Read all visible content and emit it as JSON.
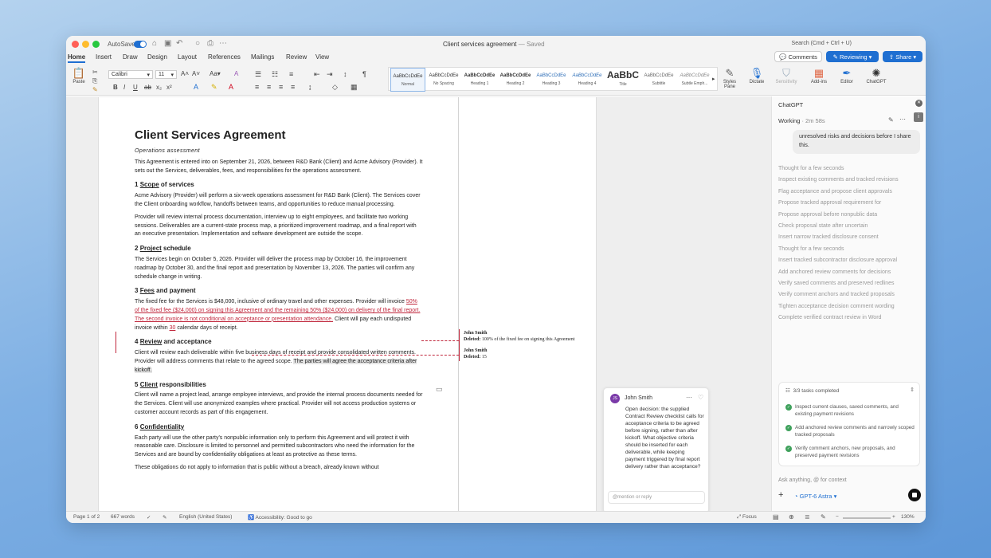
{
  "window": {
    "title": "Client services agreement",
    "saved": "— Saved",
    "autosave": "AutoSave"
  },
  "search": {
    "placeholder": "Search (Cmd + Ctrl + U)"
  },
  "tabs": [
    "Home",
    "Insert",
    "Draw",
    "Design",
    "Layout",
    "References",
    "Mailings",
    "Review",
    "View"
  ],
  "buttons": {
    "comments": "Comments",
    "reviewing": "Reviewing",
    "share": "Share"
  },
  "ribbon": {
    "paste": "Paste",
    "font": "Calibri",
    "size": "11",
    "styles": [
      {
        "sample": "AaBbCcDdEe",
        "name": "Normal"
      },
      {
        "sample": "AaBbCcDdEe",
        "name": "No Spacing"
      },
      {
        "sample": "AaBbCcDdEe",
        "name": "Heading 1"
      },
      {
        "sample": "AaBbCcDdEe",
        "name": "Heading 2"
      },
      {
        "sample": "AaBbCcDdEe",
        "name": "Heading 3"
      },
      {
        "sample": "AaBbCcDdEe",
        "name": "Heading 4"
      },
      {
        "sample": "AaBbC",
        "name": "Title"
      },
      {
        "sample": "AaBbCcDdEe",
        "name": "Subtitle"
      },
      {
        "sample": "AaBbCcDdEe",
        "name": "Subtle Emph..."
      }
    ],
    "tools": [
      "Styles Pane",
      "Dictate",
      "Sensitivity",
      "Add-ins",
      "Editor",
      "ChatGPT"
    ]
  },
  "doc": {
    "title": "Client Services Agreement",
    "subtitle": "Operations assessment",
    "intro": "This Agreement is entered into on September 21, 2026, between R&D Bank (Client) and Acme Advisory (Provider). It sets out the Services, deliverables, fees, and responsibilities for the operations assessment.",
    "s1_num": "1",
    "s1_u": "Scope",
    "s1_rest": " of services",
    "s1_p1": "Acme Advisory (Provider) will perform a six-week operations assessment for R&D Bank (Client). The Services cover the Client onboarding workflow, handoffs between teams, and opportunities to reduce manual processing.",
    "s1_p2": "Provider will review internal process documentation, interview up to eight employees, and facilitate two working sessions. Deliverables are a current-state process map, a prioritized improvement roadmap, and a final report with an executive presentation. Implementation and software development are outside the scope.",
    "s2_num": "2",
    "s2_u": "Project",
    "s2_rest": " schedule",
    "s2_p1": "The Services begin on October 5, 2026. Provider will deliver the process map by October 16, the improvement roadmap by October 30, and the final report and presentation by November 13, 2026. The parties will confirm any schedule change in writing.",
    "s3_num": "3",
    "s3_u": "Fees",
    "s3_rest": " and payment",
    "s3_a": "The fixed fee for the Services is $48,000, inclusive of ordinary travel and other expenses. Provider will invoice ",
    "s3_red": "50% of the fixed fee ($24,000) on signing this Agreement and the remaining 50% ($24,000) on delivery of the final report. The second invoice is not conditional on acceptance or presentation attendance.",
    "s3_b": " Client will pay each undisputed invoice within ",
    "s3_red2": "30",
    "s3_c": " calendar days of receipt.",
    "s4_num": "4",
    "s4_u": "Review",
    "s4_rest": " and acceptance",
    "s4_a": "Client will review each deliverable within five business days of receipt and provide consolidated written comments. Provider will address comments that relate to the agreed scope. ",
    "s4_hl": "The parties will agree the acceptance criteria after kickoff.",
    "s5_num": "5",
    "s5_u": "Client",
    "s5_rest": " responsibilities",
    "s5_p1": "Client will name a project lead, arrange employee interviews, and provide the internal process documents needed for the Services. Client will use anonymized examples where practical. Provider will not access production systems or customer account records as part of this engagement.",
    "s6_num": "6",
    "s6_u": "Confidentiality",
    "s6_rest": "",
    "s6_p1": "Each party will use the other party's nonpublic information only to perform this Agreement and will protect it with reasonable care. Disclosure is limited to personnel and permitted subcontractors who need the information for the Services and are bound by confidentiality obligations at least as protective as these terms.",
    "s6_p2": "These obligations do not apply to information that is public without a breach, already known without"
  },
  "markup": [
    {
      "author": "John Smith",
      "label": "Deleted:",
      "text": " 100% of the fixed fee on signing this Agreement"
    },
    {
      "author": "John Smith",
      "label": "Deleted:",
      "text": " 15"
    }
  ],
  "comment": {
    "initials": "JS",
    "author": "John Smith",
    "body": "Open decision: the supplied Contract Review checklist calls for acceptance criteria to be agreed before signing, rather than after kickoff. What objective criteria should be inserted for each deliverable, while keeping payment triggered by final report delivery rather than acceptance?",
    "reply_placeholder": "@mention or reply"
  },
  "panel": {
    "title": "ChatGPT",
    "status": "Working",
    "elapsed": "· 2m 58s",
    "bubble": "unresolved risks and decisions before I share this.",
    "steps": [
      "Thought for a few seconds",
      "Inspect existing comments and tracked revisions",
      "Flag acceptance and propose client approvals",
      "Propose tracked approval requirement for",
      "Propose approval before nonpublic data",
      "Check proposal state after uncertain",
      "Insert narrow tracked disclosure consent",
      "Thought for a few seconds",
      "Insert tracked subcontractor disclosure approval",
      "Add anchored review comments for decisions",
      "Verify saved comments and preserved redlines",
      "Verify comment anchors and tracked proposals",
      "Tighten acceptance decision comment wording",
      "Complete verified contract review in Word"
    ],
    "tasks_header": "3/3 tasks completed",
    "tasks": [
      "Inspect current clauses, saved comments, and existing payment revisions",
      "Add anchored review comments and narrowly scoped tracked proposals",
      "Verify comment anchors, new proposals, and preserved payment revisions"
    ],
    "ask_placeholder": "Ask anything, @ for context",
    "model": "GPT-6 Astra"
  },
  "status": {
    "page": "Page 1 of 2",
    "words": "667 words",
    "language": "English (United States)",
    "accessibility": "Accessibility: Good to go",
    "focus": "Focus",
    "zoom": "130%"
  }
}
